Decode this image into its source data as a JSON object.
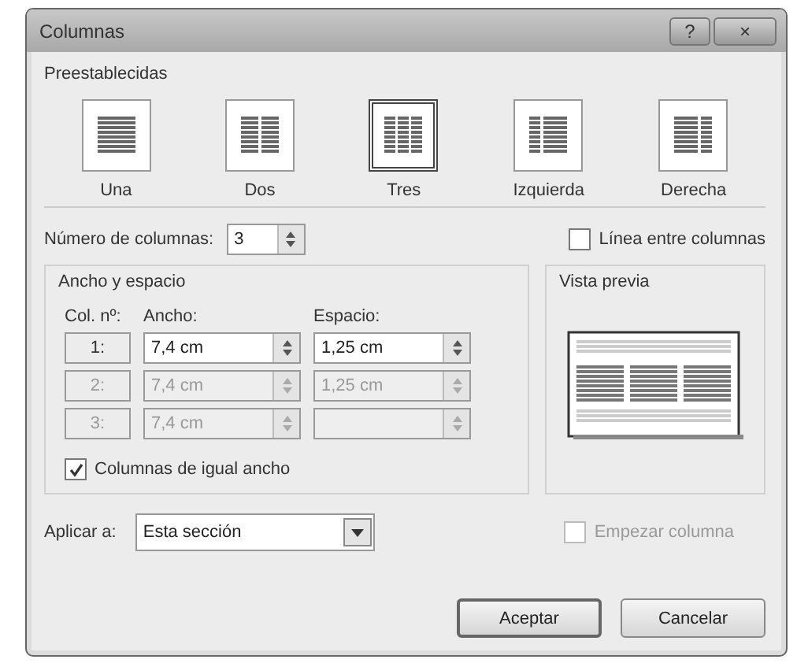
{
  "window": {
    "title": "Columnas",
    "help": "?",
    "close": "×"
  },
  "presets": {
    "title": "Preestablecidas",
    "items": [
      {
        "label": "Una",
        "kind": "one",
        "selected": false
      },
      {
        "label": "Dos",
        "kind": "two",
        "selected": false
      },
      {
        "label": "Tres",
        "kind": "three",
        "selected": true
      },
      {
        "label": "Izquierda",
        "kind": "left",
        "selected": false
      },
      {
        "label": "Derecha",
        "kind": "right",
        "selected": false
      }
    ]
  },
  "columns_count": {
    "label": "Número de columnas:",
    "value": "3"
  },
  "line_between": {
    "label": "Línea entre columnas",
    "checked": false
  },
  "width_spacing": {
    "title": "Ancho y espacio",
    "headers": [
      "Col. nº:",
      "Ancho:",
      "Espacio:"
    ],
    "rows": [
      {
        "number": "1:",
        "width": "7,4 cm",
        "spacing": "1,25 cm",
        "disabled": false
      },
      {
        "number": "2:",
        "width": "7,4 cm",
        "spacing": "1,25 cm",
        "disabled": true
      },
      {
        "number": "3:",
        "width": "7,4 cm",
        "disabled": true
      }
    ],
    "equal_width": {
      "label": "Columnas de igual ancho",
      "checked": true
    }
  },
  "preview": {
    "title": "Vista previa"
  },
  "apply_to": {
    "label": "Aplicar a:",
    "value": "Esta sección"
  },
  "start_column": {
    "label": "Empezar columna",
    "checked": false,
    "disabled": true
  },
  "buttons": [
    {
      "label": "Aceptar",
      "default": true
    },
    {
      "label": "Cancelar",
      "default": false
    }
  ]
}
